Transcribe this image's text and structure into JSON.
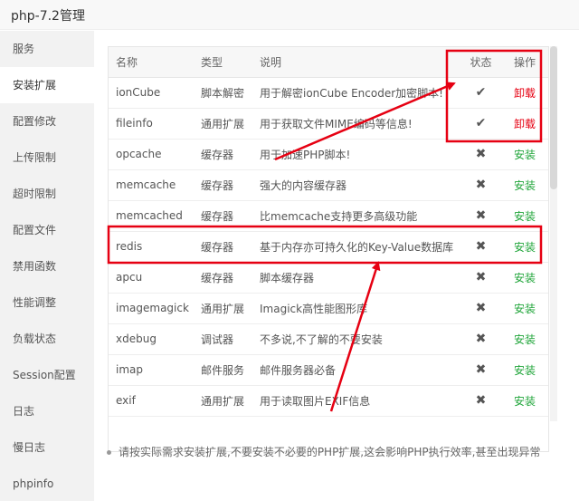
{
  "window": {
    "title": "php-7.2管理"
  },
  "sidebar": {
    "items": [
      {
        "label": "服务"
      },
      {
        "label": "安装扩展",
        "active": true
      },
      {
        "label": "配置修改"
      },
      {
        "label": "上传限制"
      },
      {
        "label": "超时限制"
      },
      {
        "label": "配置文件"
      },
      {
        "label": "禁用函数"
      },
      {
        "label": "性能调整"
      },
      {
        "label": "负载状态"
      },
      {
        "label": "Session配置"
      },
      {
        "label": "日志"
      },
      {
        "label": "慢日志"
      },
      {
        "label": "phpinfo"
      }
    ]
  },
  "table": {
    "headers": {
      "name": "名称",
      "type": "类型",
      "desc": "说明",
      "state": "状态",
      "op": "操作"
    },
    "rows": [
      {
        "name": "ionCube",
        "type": "脚本解密",
        "desc": "用于解密ionCube Encoder加密脚本!",
        "state": "✔",
        "op": "卸载",
        "installed": true
      },
      {
        "name": "fileinfo",
        "type": "通用扩展",
        "desc": "用于获取文件MIME编码等信息!",
        "state": "✔",
        "op": "卸载",
        "installed": true
      },
      {
        "name": "opcache",
        "type": "缓存器",
        "desc": "用于加速PHP脚本!",
        "state": "✖",
        "op": "安装",
        "installed": false
      },
      {
        "name": "memcache",
        "type": "缓存器",
        "desc": "强大的内容缓存器",
        "state": "✖",
        "op": "安装",
        "installed": false
      },
      {
        "name": "memcached",
        "type": "缓存器",
        "desc": "比memcache支持更多高级功能",
        "state": "✖",
        "op": "安装",
        "installed": false
      },
      {
        "name": "redis",
        "type": "缓存器",
        "desc": "基于内存亦可持久化的Key-Value数据库",
        "state": "✖",
        "op": "安装",
        "installed": false
      },
      {
        "name": "apcu",
        "type": "缓存器",
        "desc": "脚本缓存器",
        "state": "✖",
        "op": "安装",
        "installed": false
      },
      {
        "name": "imagemagick",
        "type": "通用扩展",
        "desc": "Imagick高性能图形库",
        "state": "✖",
        "op": "安装",
        "installed": false
      },
      {
        "name": "xdebug",
        "type": "调试器",
        "desc": "不多说,不了解的不要安装",
        "state": "✖",
        "op": "安装",
        "installed": false
      },
      {
        "name": "imap",
        "type": "邮件服务",
        "desc": "邮件服务器必备",
        "state": "✖",
        "op": "安装",
        "installed": false
      },
      {
        "name": "exif",
        "type": "通用扩展",
        "desc": "用于读取图片EXIF信息",
        "state": "✖",
        "op": "安装",
        "installed": false
      }
    ]
  },
  "hint": "请按实际需求安装扩展,不要安装不必要的PHP扩展,这会影响PHP执行效率,甚至出现异常",
  "colors": {
    "install": "#20a53a",
    "uninstall": "#e60012",
    "annotation": "#e60012"
  }
}
